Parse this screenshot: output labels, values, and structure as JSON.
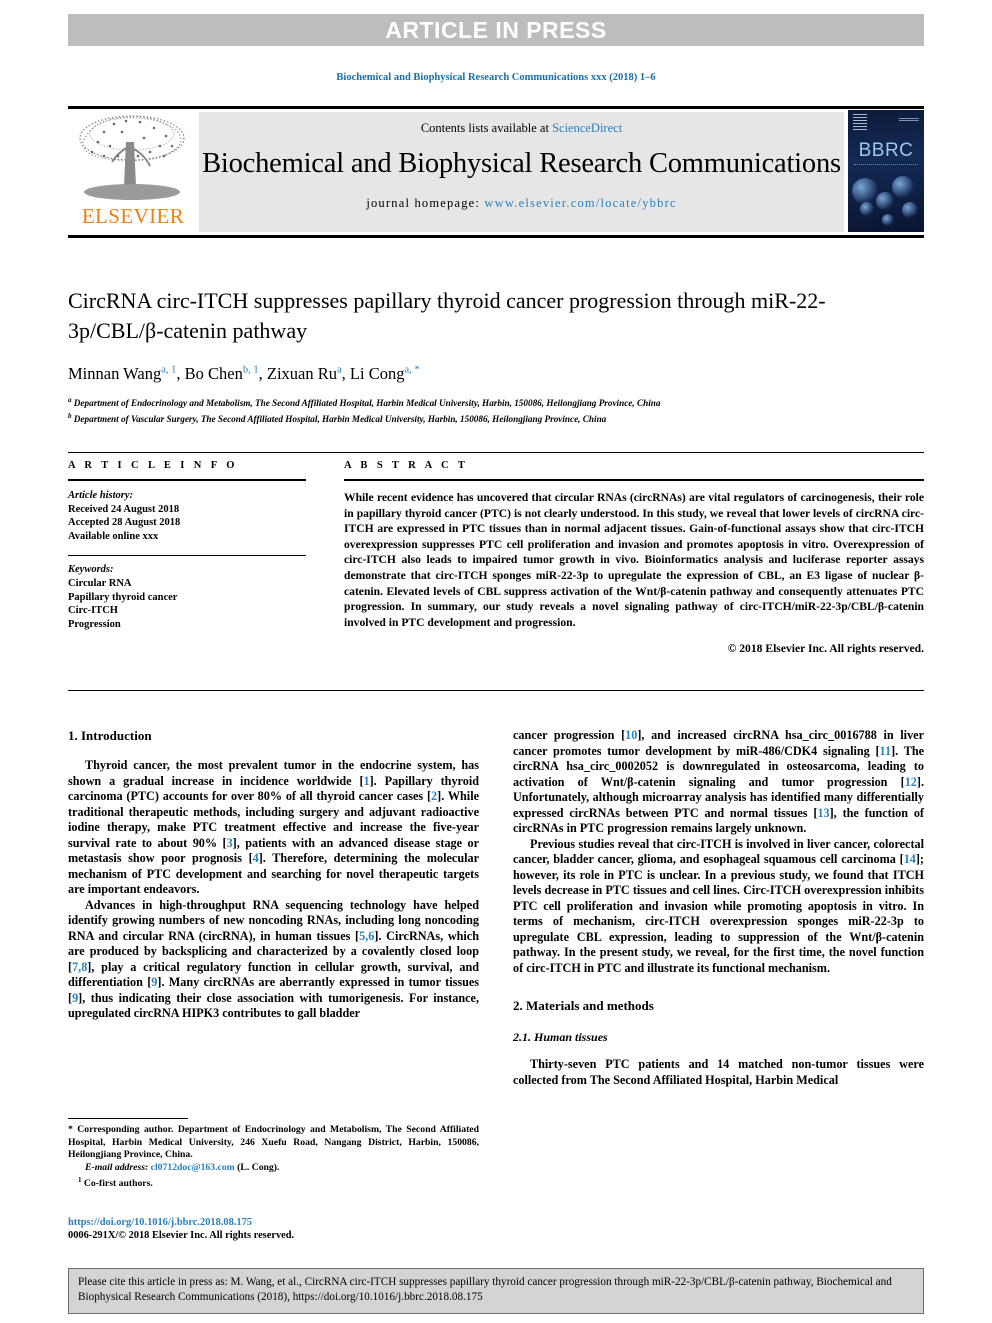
{
  "banner": {
    "article_in_press": "ARTICLE IN PRESS"
  },
  "running_head": "Biochemical and Biophysical Research Communications xxx (2018) 1–6",
  "masthead": {
    "contents_prefix": "Contents lists available at ",
    "contents_link": "ScienceDirect",
    "journal_title": "Biochemical and Biophysical Research Communications",
    "homepage_prefix": "journal homepage: ",
    "homepage_url": "www.elsevier.com/locate/ybbrc",
    "publisher": "ELSEVIER",
    "cover_mark": "BBRC"
  },
  "article": {
    "title": "CircRNA circ-ITCH suppresses papillary thyroid cancer progression through miR-22-3p/CBL/β-catenin pathway",
    "authors": [
      {
        "name": "Minnan Wang",
        "marks": "a, 1"
      },
      {
        "name": "Bo Chen",
        "marks": "b, 1"
      },
      {
        "name": "Zixuan Ru",
        "marks": "a"
      },
      {
        "name": "Li Cong",
        "marks": "a, *"
      }
    ],
    "affiliations": [
      {
        "mark": "a",
        "text": "Department of Endocrinology and Metabolism, The Second Affiliated Hospital, Harbin Medical University, Harbin, 150086, Heilongjiang Province, China"
      },
      {
        "mark": "b",
        "text": "Department of Vascular Surgery, The Second Affiliated Hospital, Harbin Medical University, Harbin, 150086, Heilongjiang Province, China"
      }
    ]
  },
  "info": {
    "heading": "A R T I C L E  I N F O",
    "history_label": "Article history:",
    "history": [
      "Received 24 August 2018",
      "Accepted 28 August 2018",
      "Available online xxx"
    ],
    "keywords_label": "Keywords:",
    "keywords": [
      "Circular RNA",
      "Papillary thyroid cancer",
      "Circ-ITCH",
      "Progression"
    ]
  },
  "abstract": {
    "heading": "A B S T R A C T",
    "text": "While recent evidence has uncovered that circular RNAs (circRNAs) are vital regulators of carcinogenesis, their role in papillary thyroid cancer (PTC) is not clearly understood. In this study, we reveal that lower levels of circRNA circ-ITCH are expressed in PTC tissues than in normal adjacent tissues. Gain-of-functional assays show that circ-ITCH overexpression suppresses PTC cell proliferation and invasion and promotes apoptosis in vitro. Overexpression of circ-ITCH also leads to impaired tumor growth in vivo. Bioinformatics analysis and luciferase reporter assays demonstrate that circ-ITCH sponges miR-22-3p to upregulate the expression of CBL, an E3 ligase of nuclear β-catenin. Elevated levels of CBL suppress activation of the Wnt/β-catenin pathway and consequently attenuates PTC progression. In summary, our study reveals a novel signaling pathway of circ-ITCH/miR-22-3p/CBL/β-catenin involved in PTC development and progression.",
    "copyright": "© 2018 Elsevier Inc. All rights reserved."
  },
  "sections": {
    "intro_heading": "1. Introduction",
    "intro_p1_a": "Thyroid cancer, the most prevalent tumor in the endocrine system, has shown a gradual increase in incidence worldwide [",
    "intro_p1_r1": "1",
    "intro_p1_b": "]. Papillary thyroid carcinoma (PTC) accounts for over 80% of all thyroid cancer cases [",
    "intro_p1_r2": "2",
    "intro_p1_c": "]. While traditional therapeutic methods, including surgery and adjuvant radioactive iodine therapy, make PTC treatment effective and increase the five-year survival rate to about 90% [",
    "intro_p1_r3": "3",
    "intro_p1_d": "], patients with an advanced disease stage or metastasis show poor prognosis [",
    "intro_p1_r4": "4",
    "intro_p1_e": "]. Therefore, determining the molecular mechanism of PTC development and searching for novel therapeutic targets are important endeavors.",
    "intro_p2_a": "Advances in high-throughput RNA sequencing technology have helped identify growing numbers of new noncoding RNAs, including long noncoding RNA and circular RNA (circRNA), in human tissues [",
    "intro_p2_r1": "5,6",
    "intro_p2_b": "]. CircRNAs, which are produced by backsplicing and characterized by a covalently closed loop [",
    "intro_p2_r2": "7,8",
    "intro_p2_c": "], play a critical regulatory function in cellular growth, survival, and differentiation [",
    "intro_p2_r3": "9",
    "intro_p2_d": "]. Many circRNAs are aberrantly expressed in tumor tissues [",
    "intro_p2_r4": "9",
    "intro_p2_e": "], thus indicating their close association with tumorigenesis. For instance, upregulated circRNA HIPK3 contributes to gall bladder",
    "rcol_p1_a": "cancer progression [",
    "rcol_p1_r1": "10",
    "rcol_p1_b": "], and increased circRNA hsa_circ_0016788 in liver cancer promotes tumor development by miR-486/CDK4 signaling [",
    "rcol_p1_r2": "11",
    "rcol_p1_c": "]. The circRNA hsa_circ_0002052 is downregulated in osteosarcoma, leading to activation of Wnt/β-catenin signaling and tumor progression [",
    "rcol_p1_r3": "12",
    "rcol_p1_d": "]. Unfortunately, although microarray analysis has identified many differentially expressed circRNAs between PTC and normal tissues [",
    "rcol_p1_r4": "13",
    "rcol_p1_e": "], the function of circRNAs in PTC progression remains largely unknown.",
    "rcol_p2_a": "Previous studies reveal that circ-ITCH is involved in liver cancer, colorectal cancer, bladder cancer, glioma, and esophageal squamous cell carcinoma [",
    "rcol_p2_r1": "14",
    "rcol_p2_b": "]; however, its role in PTC is unclear. In a previous study, we found that ITCH levels decrease in PTC tissues and cell lines. Circ-ITCH overexpression inhibits PTC cell proliferation and invasion while promoting apoptosis in vitro. In terms of mechanism, circ-ITCH overexpression sponges miR-22-3p to upregulate CBL expression, leading to suppression of the Wnt/β-catenin pathway. In the present study, we reveal, for the first time, the novel function of circ-ITCH in PTC and illustrate its functional mechanism.",
    "methods_heading": "2. Materials and methods",
    "methods_sub_heading": "2.1. Human tissues",
    "methods_p1": "Thirty-seven PTC patients and 14 matched non-tumor tissues were collected from The Second Affiliated Hospital, Harbin Medical"
  },
  "footnotes": {
    "corresponding_star": "* ",
    "corresponding": "Corresponding author. Department of Endocrinology and Metabolism, The Second Affiliated Hospital, Harbin Medical University, 246 Xuefu Road, Nangang District, Harbin, 150086, Heilongjiang Province, China.",
    "email_label": "E-mail address: ",
    "email": "cl0712doc@163.com",
    "email_owner": " (L. Cong).",
    "cofirst_mark": "1",
    "cofirst": " Co-first authors.",
    "doi_url": "https://doi.org/10.1016/j.bbrc.2018.08.175",
    "issn_line": "0006-291X/© 2018 Elsevier Inc. All rights reserved."
  },
  "cite_box": {
    "text": "Please cite this article in press as: M. Wang, et al., CircRNA circ-ITCH suppresses papillary thyroid cancer progression through miR-22-3p/CBL/β-catenin pathway, Biochemical and Biophysical Research Communications (2018), https://doi.org/10.1016/j.bbrc.2018.08.175"
  },
  "colors": {
    "link": "#2a7fbd",
    "banner_gray": "#bdbdbd",
    "masthead_gray": "#e6e6e6",
    "cite_gray": "#d4d4d4",
    "elsevier_orange": "#f07f13"
  }
}
